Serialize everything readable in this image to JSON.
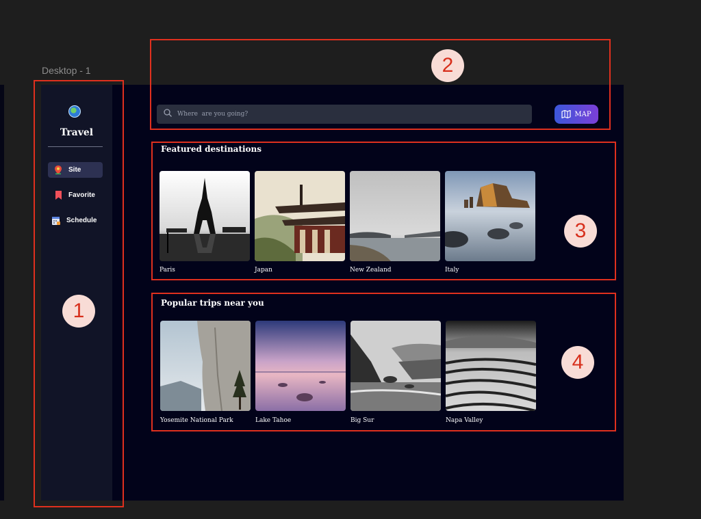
{
  "canvas": {
    "label": "Desktop - 1"
  },
  "sidebar": {
    "brand": "Travel",
    "items": [
      {
        "label": "Site",
        "icon": "pin-icon",
        "active": true
      },
      {
        "label": "Favorite",
        "icon": "bookmark-icon",
        "active": false
      },
      {
        "label": "Schedule",
        "icon": "calendar-icon",
        "active": false
      }
    ]
  },
  "search": {
    "placeholder": "Where  are you going?",
    "value": ""
  },
  "map_button": {
    "label": "MAP",
    "icon": "map-icon"
  },
  "featured": {
    "title": "Featured destinations",
    "items": [
      {
        "caption": "Paris",
        "image": "eiffel-tower-photo"
      },
      {
        "caption": "Japan",
        "image": "japanese-temple-photo"
      },
      {
        "caption": "New Zealand",
        "image": "lake-coast-photo"
      },
      {
        "caption": "Italy",
        "image": "sea-cliffs-photo"
      }
    ]
  },
  "popular": {
    "title": "Popular trips near you",
    "items": [
      {
        "caption": "Yosemite National Park",
        "image": "granite-cliff-photo"
      },
      {
        "caption": "Lake Tahoe",
        "image": "lake-sunset-photo"
      },
      {
        "caption": "Big Sur",
        "image": "coastline-photo"
      },
      {
        "caption": "Napa Valley",
        "image": "vineyard-rows-photo"
      }
    ]
  },
  "annotations": [
    "1",
    "2",
    "3",
    "4"
  ],
  "colors": {
    "annotation": "#e0301e",
    "frame_bg": "#02031a",
    "sidebar_bg": "#111427",
    "accent_start": "#3c57d9",
    "accent_end": "#7b3fd8"
  }
}
